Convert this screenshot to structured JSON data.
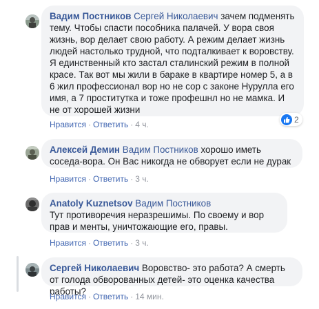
{
  "comments": [
    {
      "author": "Вадим Постников",
      "mention": "Сергей Николаевич",
      "text": " зачем подменять тему. Чтобы спасти пособника палачей. У вора своя жизнь, вор делает свою работу. А режим делает жизнь людей настолько трудной, что подталкивает к воровству. Я единственный кто застал сталинский режим в полной красе. Так вот мы жили в бараке в квартире номер 5, а в 6 жил профессионал вор но не сор с законе Нурулла его имя, а 7 проститутка и тоже профешнл но не мамка. И не от хорошей жизни",
      "like_label": "Нравится",
      "reply_label": "Ответить",
      "time": "4 ч.",
      "reaction_count": "2",
      "reaction_icon": "like-icon",
      "reaction_color": "#1877f2"
    },
    {
      "author": "Алексей Демин",
      "mention": "Вадим Постников",
      "text": " хорошо иметь соседа-вора. Он Вас никогда не обворует если не дурак",
      "like_label": "Нравится",
      "reply_label": "Ответить",
      "time": "3 ч."
    },
    {
      "author": "Anatoly Kuznetsov",
      "mention": "Вадим Постников",
      "text": "Тут противоречия неразрешимы. По своему и вор прав и менты, уничтожающие его, правы.",
      "like_label": "Нравится",
      "reply_label": "Ответить",
      "time": "3 ч."
    },
    {
      "author": "Сергей Николаевич",
      "mention": "",
      "text": "Воровство- это работа? А смерть от голода обворованных детей- это оценка качества работы?",
      "like_label": "Нравится",
      "reply_label": "Ответить",
      "time": "14 мин."
    }
  ],
  "colors": {
    "link": "#385898",
    "action": "#4267b2",
    "bubble": "#f2f3f5",
    "meta": "#90949c"
  }
}
